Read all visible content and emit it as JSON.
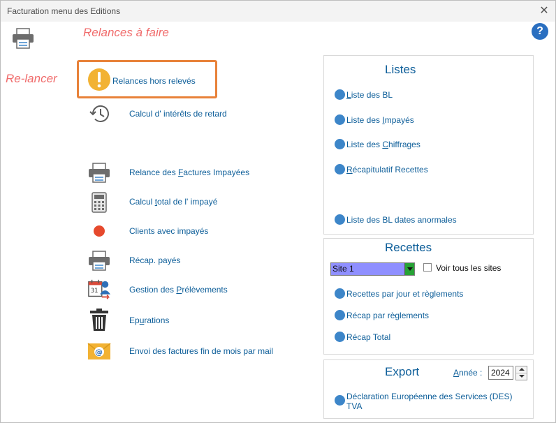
{
  "window": {
    "title": "Facturation menu des Editions",
    "close_glyph": "✕"
  },
  "annotations": {
    "relances_a_faire": "Relances à faire",
    "re_lancer": "Re-lancer"
  },
  "help_glyph": "?",
  "menu": {
    "relances_hors_releves": "Relances hors relevés",
    "calcul_interets": "Calcul d' intérêts de retard",
    "relance_factures": {
      "pre": "Relance des ",
      "u": "F",
      "post": "actures Impayées"
    },
    "calcul_total": {
      "pre": "Calcul ",
      "u": "t",
      "post": "otal de l' impayé"
    },
    "clients_impayes": "Clients avec  impayés",
    "recap_payes": "Récap. payés",
    "gestion_prelevements": {
      "pre": "Gestion des ",
      "u": "P",
      "post": "rélèvements"
    },
    "epurations": {
      "pre": "Ep",
      "u": "u",
      "post": "rations"
    },
    "envoi_factures": "Envoi des factures fin de mois par mail"
  },
  "listes": {
    "title": "Listes",
    "items": [
      {
        "pre": "",
        "u": "L",
        "post": "iste des BL"
      },
      {
        "pre": "Liste des ",
        "u": "I",
        "post": "mpayés"
      },
      {
        "pre": "Liste des ",
        "u": "C",
        "post": "hiffrages"
      },
      {
        "pre": "",
        "u": "R",
        "post": "écapitulatif Recettes"
      },
      {
        "pre": "Liste des BL dates anormales",
        "u": "",
        "post": ""
      }
    ]
  },
  "recettes": {
    "title": "Recettes",
    "site_select": "Site 1",
    "voir_tous": "Voir tous les sites",
    "items": [
      "Recettes par jour et règlements",
      "Récap par règlements",
      "Récap Total"
    ]
  },
  "export": {
    "title": "Export",
    "annee_label_u": "A",
    "annee_label_post": "nnée :",
    "annee_value": "2024",
    "des_line1": "Déclaration Européenne des Services (DES)",
    "des_line2": "TVA"
  },
  "colors": {
    "link_blue": "#0d5e99",
    "dot_blue": "#3d86c9",
    "annotation_pink": "#f06b6b",
    "highlight_orange": "#e8823a",
    "select_fill": "#8f8fff",
    "select_button": "#27a236",
    "alert_yellow": "#f2b233",
    "client_red": "#e6492d"
  }
}
